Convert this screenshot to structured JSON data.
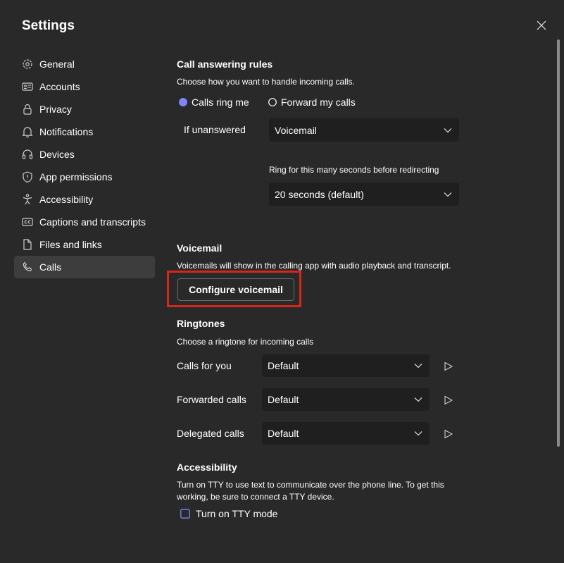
{
  "window": {
    "title": "Settings"
  },
  "sidebar": {
    "items": [
      {
        "label": "General",
        "icon": "gear-icon"
      },
      {
        "label": "Accounts",
        "icon": "id-card-icon"
      },
      {
        "label": "Privacy",
        "icon": "lock-icon"
      },
      {
        "label": "Notifications",
        "icon": "bell-icon"
      },
      {
        "label": "Devices",
        "icon": "headset-icon"
      },
      {
        "label": "App permissions",
        "icon": "shield-icon"
      },
      {
        "label": "Accessibility",
        "icon": "accessibility-icon"
      },
      {
        "label": "Captions and transcripts",
        "icon": "cc-icon"
      },
      {
        "label": "Files and links",
        "icon": "file-icon"
      },
      {
        "label": "Calls",
        "icon": "phone-icon",
        "selected": true
      }
    ]
  },
  "call_answering": {
    "heading": "Call answering rules",
    "description": "Choose how you want to handle incoming calls.",
    "option_ring": "Calls ring me",
    "option_forward": "Forward my calls",
    "selected_option": "Calls ring me",
    "if_unanswered_label": "If unanswered",
    "if_unanswered_value": "Voicemail",
    "ring_label": "Ring for this many seconds before redirecting",
    "ring_value": "20 seconds (default)"
  },
  "voicemail": {
    "heading": "Voicemail",
    "description": "Voicemails will show in the calling app with audio playback and transcript.",
    "button_label": "Configure voicemail"
  },
  "ringtones": {
    "heading": "Ringtones",
    "description": "Choose a ringtone for incoming calls",
    "rows": [
      {
        "label": "Calls for you",
        "value": "Default"
      },
      {
        "label": "Forwarded calls",
        "value": "Default"
      },
      {
        "label": "Delegated calls",
        "value": "Default"
      }
    ]
  },
  "accessibility": {
    "heading": "Accessibility",
    "description_line1": "Turn on TTY to use text to communicate over the phone line. To get this",
    "description_line2": "working, be sure to connect a TTY device.",
    "tty_label": "Turn on TTY mode",
    "tty_checked": false
  },
  "colors": {
    "accent": "#7f85f5",
    "highlight": "#d9261c",
    "background": "#292929",
    "field": "#1f1f1f"
  }
}
